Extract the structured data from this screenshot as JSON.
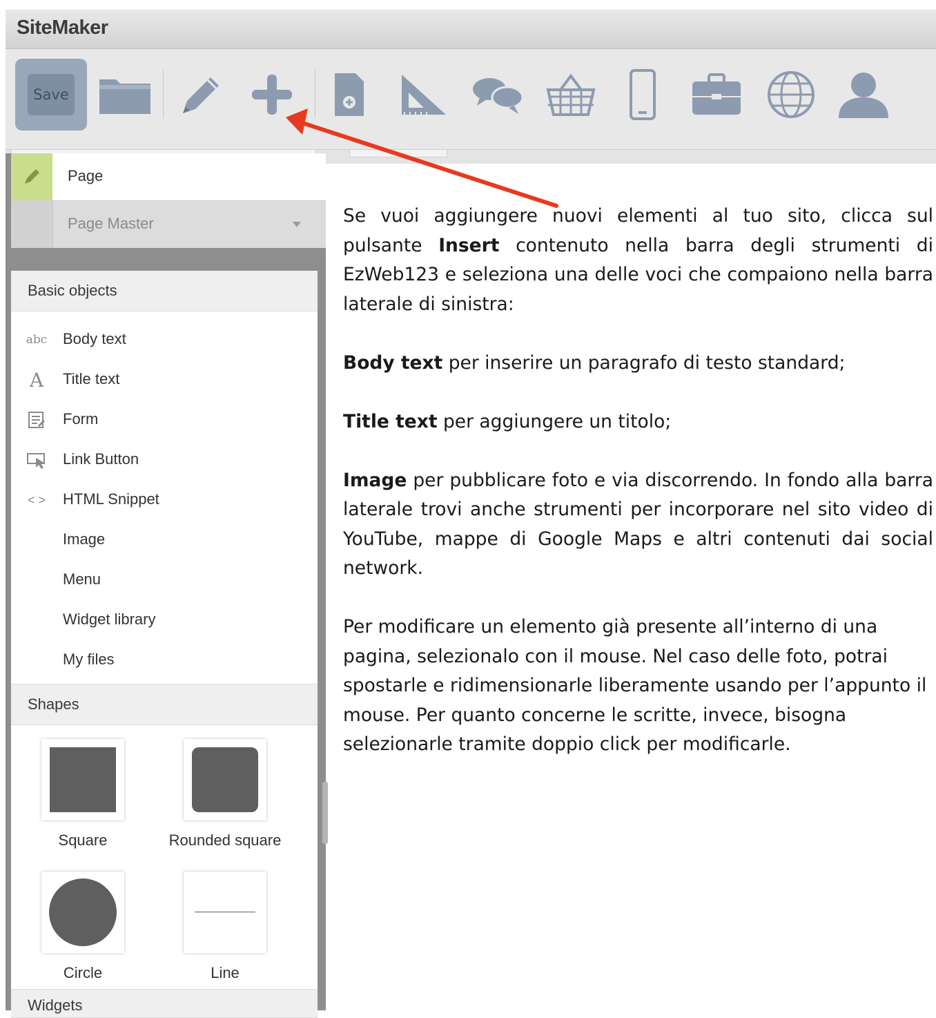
{
  "window": {
    "title": "SiteMaker"
  },
  "toolbar": {
    "save_label": "Save",
    "tools": [
      {
        "icon": "folder-icon"
      },
      {
        "icon": "pen-icon"
      },
      {
        "icon": "plus-icon"
      },
      {
        "icon": "page-add-icon"
      },
      {
        "icon": "set-square-icon"
      },
      {
        "icon": "chat-bubbles-icon"
      },
      {
        "icon": "basket-icon"
      },
      {
        "icon": "mobile-icon"
      },
      {
        "icon": "briefcase-icon"
      },
      {
        "icon": "globe-icon"
      },
      {
        "icon": "user-icon"
      }
    ]
  },
  "sidebar": {
    "page_label": "Page",
    "master_label": "Page Master",
    "basic_header": "Basic objects",
    "basic_items": [
      {
        "icon": "abc-icon",
        "label": "Body text"
      },
      {
        "icon": "title-a-icon",
        "label": "Title text"
      },
      {
        "icon": "form-icon",
        "label": "Form"
      },
      {
        "icon": "link-button-icon",
        "label": "Link Button"
      },
      {
        "icon": "code-icon",
        "label": "HTML Snippet"
      },
      {
        "icon": "",
        "label": "Image"
      },
      {
        "icon": "",
        "label": "Menu"
      },
      {
        "icon": "",
        "label": "Widget library"
      },
      {
        "icon": "",
        "label": "My files"
      }
    ],
    "shapes_header": "Shapes",
    "shapes": [
      "Square",
      "Rounded square",
      "Circle",
      "Line"
    ],
    "widgets_header": "Widgets"
  },
  "content": {
    "p1_a": "Se vuoi aggiungere nuovi elementi al tuo sito, clicca sul pulsante ",
    "p1_b": "Insert",
    "p1_c": " contenuto nella barra degli strumenti di EzWeb123 e seleziona una delle voci che compaiono nella barra laterale di sinistra:",
    "p2_b": "Body text",
    "p2_c": " per inserire un paragrafo di testo standard;",
    "p3_b": "Title text",
    "p3_c": " per aggiungere un titolo;",
    "p4_b": "Image",
    "p4_c": " per pubblicare foto e via discorrendo. In fondo alla barra laterale trovi anche strumenti per incorporare nel sito video di YouTube, mappe di Google Maps e altri contenuti dai social network.",
    "p5": "Per modificare un elemento già presente all’interno di una pagina, selezionalo con il mouse. Nel caso delle foto, potrai spostarle e ridimensionarle liberamente usando per l’appunto il mouse. Per quanto concerne le scritte, invece, bisogna selezionarle tramite doppio click per modificarle."
  },
  "colors": {
    "annotation_arrow": "#e8391f",
    "toolbar_icon": "#8d9bb0",
    "page_pencil_bg": "#c9dd8c"
  }
}
